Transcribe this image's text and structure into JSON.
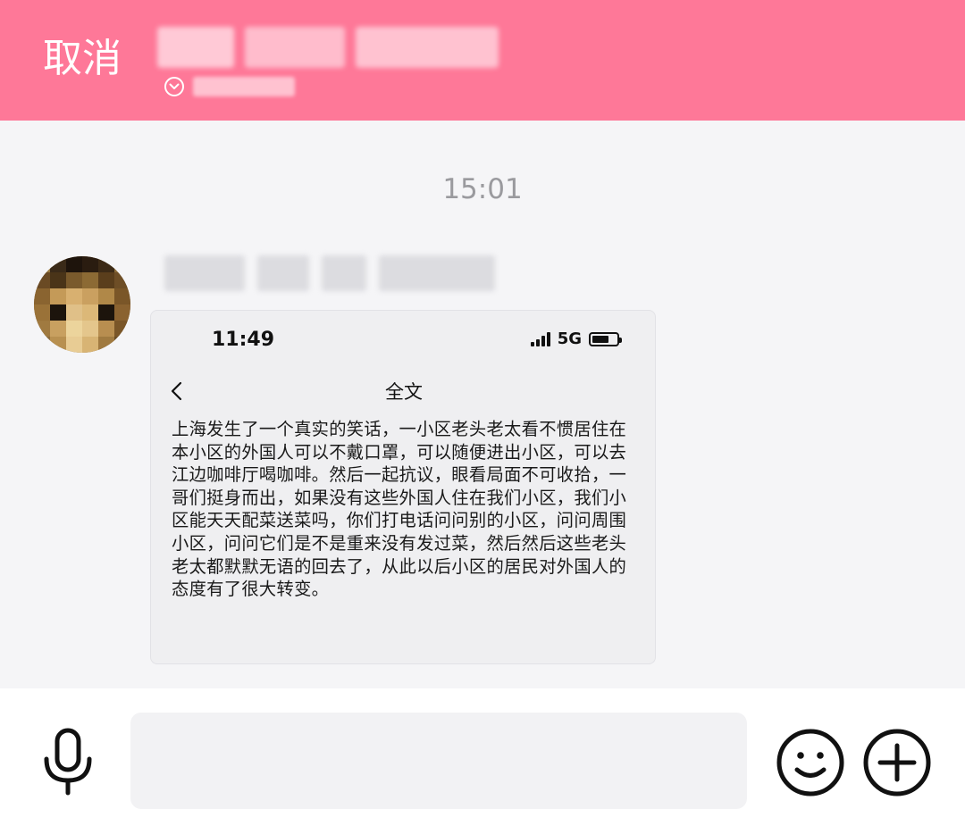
{
  "header": {
    "cancel_label": "取消",
    "background_color": "#fe7898",
    "title_obscured": true,
    "subtitle_icon": "chevron-down-circle-icon"
  },
  "chat": {
    "timestamp": "15:01",
    "message": {
      "sender_name_obscured": true,
      "screenshot": {
        "status_time": "11:49",
        "network_label": "5G",
        "page_title": "全文",
        "body_text": "上海发生了一个真实的笑话，一小区老头老太看不惯居住在本小区的外国人可以不戴口罩，可以随便进出小区，可以去江边咖啡厅喝咖啡。然后一起抗议，眼看局面不可收拾，一哥们挺身而出，如果没有这些外国人住在我们小区，我们小区能天天配菜送菜吗，你们打电话问问别的小区，问问周围小区，问问它们是不是重来没有发过菜，然后然后这些老头老太都默默无语的回去了，从此以后小区的居民对外国人的态度有了很大转变。"
      }
    }
  },
  "footer": {
    "input_value": "",
    "mic_icon": "microphone-icon",
    "emoji_icon": "smiley-icon",
    "plus_icon": "plus-circle-icon"
  }
}
